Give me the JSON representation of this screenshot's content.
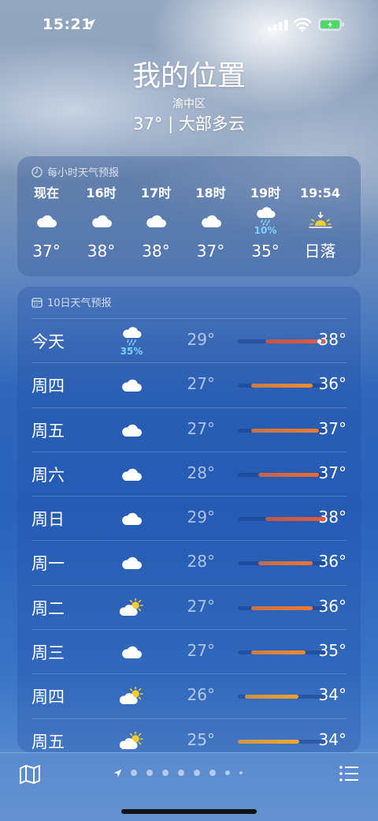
{
  "status_bar": {
    "time": "15:21"
  },
  "header": {
    "city": "我的位置",
    "district": "渝中区",
    "summary": "37° | 大部多云"
  },
  "hourly": {
    "title": "每小时天气预报",
    "hours": [
      {
        "label": "现在",
        "icon": "cloud-icon",
        "pop": "",
        "temp": "37°"
      },
      {
        "label": "16时",
        "icon": "cloud-icon",
        "pop": "",
        "temp": "38°"
      },
      {
        "label": "17时",
        "icon": "cloud-icon",
        "pop": "",
        "temp": "38°"
      },
      {
        "label": "18时",
        "icon": "cloud-icon",
        "pop": "",
        "temp": "37°"
      },
      {
        "label": "19时",
        "icon": "cloud-rain-icon",
        "pop": "10%",
        "temp": "35°"
      },
      {
        "label": "19:54",
        "icon": "sunset-icon",
        "pop": "",
        "temp": "日落"
      }
    ]
  },
  "daily": {
    "title": "10日天气预报",
    "range": [
      25,
      38
    ],
    "days": [
      {
        "day": "今天",
        "icon": "cloud-rain-icon",
        "pop": "35%",
        "low": "29°",
        "high": "38°",
        "low_v": 29,
        "high_v": 38,
        "current_v": 37,
        "color": "#e8583a"
      },
      {
        "day": "周四",
        "icon": "cloud-icon",
        "pop": "",
        "low": "27°",
        "high": "36°",
        "low_v": 27,
        "high_v": 36,
        "color": "#f28a2e"
      },
      {
        "day": "周五",
        "icon": "cloud-icon",
        "pop": "",
        "low": "27°",
        "high": "37°",
        "low_v": 27,
        "high_v": 37,
        "color": "#f07a30"
      },
      {
        "day": "周六",
        "icon": "cloud-icon",
        "pop": "",
        "low": "28°",
        "high": "37°",
        "low_v": 28,
        "high_v": 37,
        "color": "#ee6a33"
      },
      {
        "day": "周日",
        "icon": "cloud-icon",
        "pop": "",
        "low": "29°",
        "high": "38°",
        "low_v": 29,
        "high_v": 38,
        "color": "#e85a38"
      },
      {
        "day": "周一",
        "icon": "cloud-icon",
        "pop": "",
        "low": "28°",
        "high": "36°",
        "low_v": 28,
        "high_v": 36,
        "color": "#ef7431"
      },
      {
        "day": "周二",
        "icon": "partly-sunny-icon",
        "pop": "",
        "low": "27°",
        "high": "36°",
        "low_v": 27,
        "high_v": 36,
        "color": "#f07a30"
      },
      {
        "day": "周三",
        "icon": "cloud-icon",
        "pop": "",
        "low": "27°",
        "high": "35°",
        "low_v": 27,
        "high_v": 35,
        "color": "#f28a2e"
      },
      {
        "day": "周四",
        "icon": "partly-sunny-icon",
        "pop": "",
        "low": "26°",
        "high": "34°",
        "low_v": 26,
        "high_v": 34,
        "color": "#f5a02a"
      },
      {
        "day": "周五",
        "icon": "partly-sunny-icon",
        "pop": "",
        "low": "25°",
        "high": "34°",
        "low_v": 25,
        "high_v": 34,
        "color": "#f5a82a"
      }
    ]
  },
  "toolbar": {
    "page_count": 9,
    "current_page": 0
  }
}
